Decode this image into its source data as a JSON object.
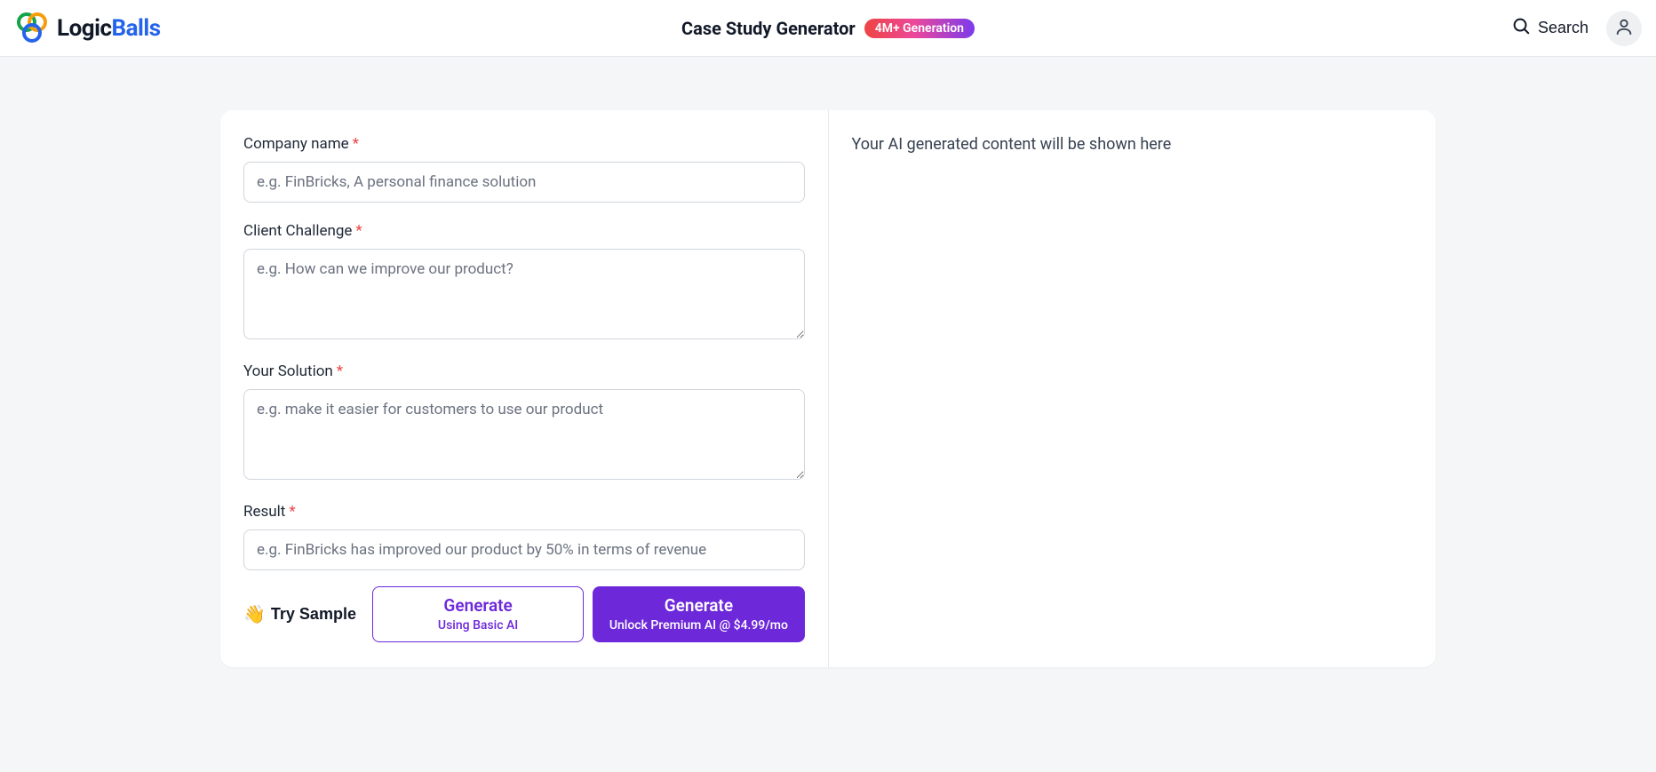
{
  "header": {
    "logo_part1": "Logic",
    "logo_part2": "Balls",
    "title": "Case Study Generator",
    "badge": "4M+ Generation",
    "search_label": "Search"
  },
  "form": {
    "fields": {
      "company": {
        "label": "Company name",
        "placeholder": "e.g. FinBricks, A personal finance solution",
        "value": ""
      },
      "challenge": {
        "label": "Client Challenge",
        "placeholder": "e.g. How can we improve our product?",
        "value": ""
      },
      "solution": {
        "label": "Your Solution",
        "placeholder": "e.g. make it easier for customers to use our product",
        "value": ""
      },
      "result": {
        "label": "Result",
        "placeholder": "e.g. FinBricks has improved our product by 50% in terms of revenue",
        "value": ""
      }
    },
    "required_mark": "*",
    "actions": {
      "try_sample": "Try Sample",
      "try_sample_emoji": "👋",
      "basic_title": "Generate",
      "basic_sub": "Using Basic AI",
      "premium_title": "Generate",
      "premium_sub": "Unlock Premium AI @ $4.99/mo"
    }
  },
  "output": {
    "placeholder": "Your AI generated content will be shown here"
  }
}
